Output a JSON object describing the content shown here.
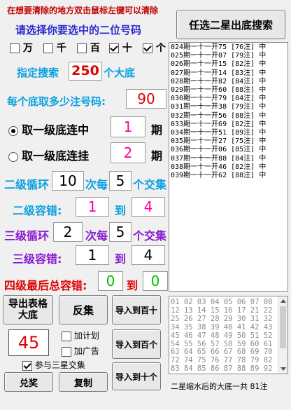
{
  "hint": "在想要清除的地方双击鼠标左键可以清除",
  "select_prompt": "请选择你要选中的二位号码",
  "positions": [
    {
      "label": "万",
      "checked": false
    },
    {
      "label": "千",
      "checked": false
    },
    {
      "label": "百",
      "checked": false
    },
    {
      "label": "十",
      "checked": true
    },
    {
      "label": "个",
      "checked": true
    }
  ],
  "search_button": "任选二星出底搜索",
  "specified": {
    "label": "指定搜索",
    "value": "250",
    "suffix": "个大底"
  },
  "per_base": {
    "label": "每个底取多少注号码:",
    "value": "90"
  },
  "level1_chain": {
    "label": "取一级底连中",
    "value": "1",
    "suffix": "期",
    "selected": true
  },
  "level1_hang": {
    "label": "取一级底连挂",
    "value": "2",
    "suffix": "期",
    "selected": false
  },
  "level2_loop": {
    "label": "二级循环",
    "value": "10",
    "mid": "次每",
    "value2": "5",
    "suffix": "个交集"
  },
  "level2_tol": {
    "label": "二级容错:",
    "from": "1",
    "to_label": "到",
    "to": "4"
  },
  "level3_loop": {
    "label": "三级循环",
    "value": "2",
    "mid": "次每",
    "value2": "5",
    "suffix": "个交集"
  },
  "level3_tol": {
    "label": "三级容错:",
    "from": "1",
    "to_label": "到",
    "to": "4"
  },
  "level4_tol": {
    "label": "四级最后总容错:",
    "from": "0",
    "to_label": "到",
    "to": "0"
  },
  "history": [
    "024期一十一开75 [76注] 中",
    "025期一十一开07 [79注] 中",
    "026期一十一开15 [82注] 中",
    "027期一十一开14 [83注] 中",
    "028期一十一开82 [84注] 中",
    "029期一十一开60 [88注] 中",
    "030期一十一开79 [84注] 中",
    "031期一十一开38 [79注] 中",
    "032期一十一开56 [88注] 中",
    "033期一十一开69 [82注] 中",
    "034期一十一开51 [89注] 中",
    "035期一十一开27 [75注] 中",
    "036期一十一开06 [85注] 中",
    "037期一十一开88 [84注] 中",
    "038期一十一开46 [82注] 中",
    "039期一十一开62 [88注] 中"
  ],
  "buttons": {
    "export": "导出表格\n大底",
    "reverse": "反集",
    "import_ten": "导入到百十",
    "import_hundred": "导入到百个",
    "import_unit": "导入到十个",
    "redeem": "兑奖",
    "copy": "复制"
  },
  "count_value": "45",
  "options": [
    {
      "label": "加计划",
      "checked": false
    },
    {
      "label": "加广告",
      "checked": false
    },
    {
      "label": "参与三星交集",
      "checked": true
    }
  ],
  "numbers_grid": [
    "01 02 03 04 05 06 07 08",
    "12 13 14 15 16 17 21 22",
    "25 26 27 28 29 30 31 32",
    "34 35 38 39 40 41 42 43",
    "45 46 47 48 49 50 51 52",
    "54 55 56 57 58 59 60 61",
    "63 64 65 66 67 68 69 70",
    "72 74 75 76 77 78 79 82",
    "83 84 85 86 87 88 89 92"
  ],
  "status_text": "二星缩水后的大底一共 81注",
  "colors": {
    "cyan": "#0aa0e0",
    "purple": "#8a1ad0",
    "blue": "#2a2ad0",
    "red": "#e00000",
    "pink": "#ff00a0",
    "green": "#00c000"
  }
}
